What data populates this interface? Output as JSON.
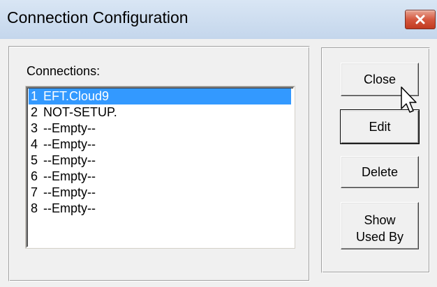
{
  "window": {
    "title": "Connection Configuration"
  },
  "connections": {
    "label": "Connections:",
    "items": [
      {
        "num": "1",
        "name": "EFT.Cloud9",
        "selected": true
      },
      {
        "num": "2",
        "name": "NOT-SETUP.",
        "selected": false
      },
      {
        "num": "3",
        "name": "--Empty--",
        "selected": false
      },
      {
        "num": "4",
        "name": "--Empty--",
        "selected": false
      },
      {
        "num": "5",
        "name": "--Empty--",
        "selected": false
      },
      {
        "num": "6",
        "name": "--Empty--",
        "selected": false
      },
      {
        "num": "7",
        "name": "--Empty--",
        "selected": false
      },
      {
        "num": "8",
        "name": "--Empty--",
        "selected": false
      }
    ]
  },
  "buttons": {
    "close": "Close",
    "edit": "Edit",
    "delete": "Delete",
    "show_used_by_line1": "Show",
    "show_used_by_line2": "Used By"
  },
  "colors": {
    "selection": "#3399ff",
    "window_bg": "#f0f0f0",
    "close_button": "#c13a20"
  }
}
